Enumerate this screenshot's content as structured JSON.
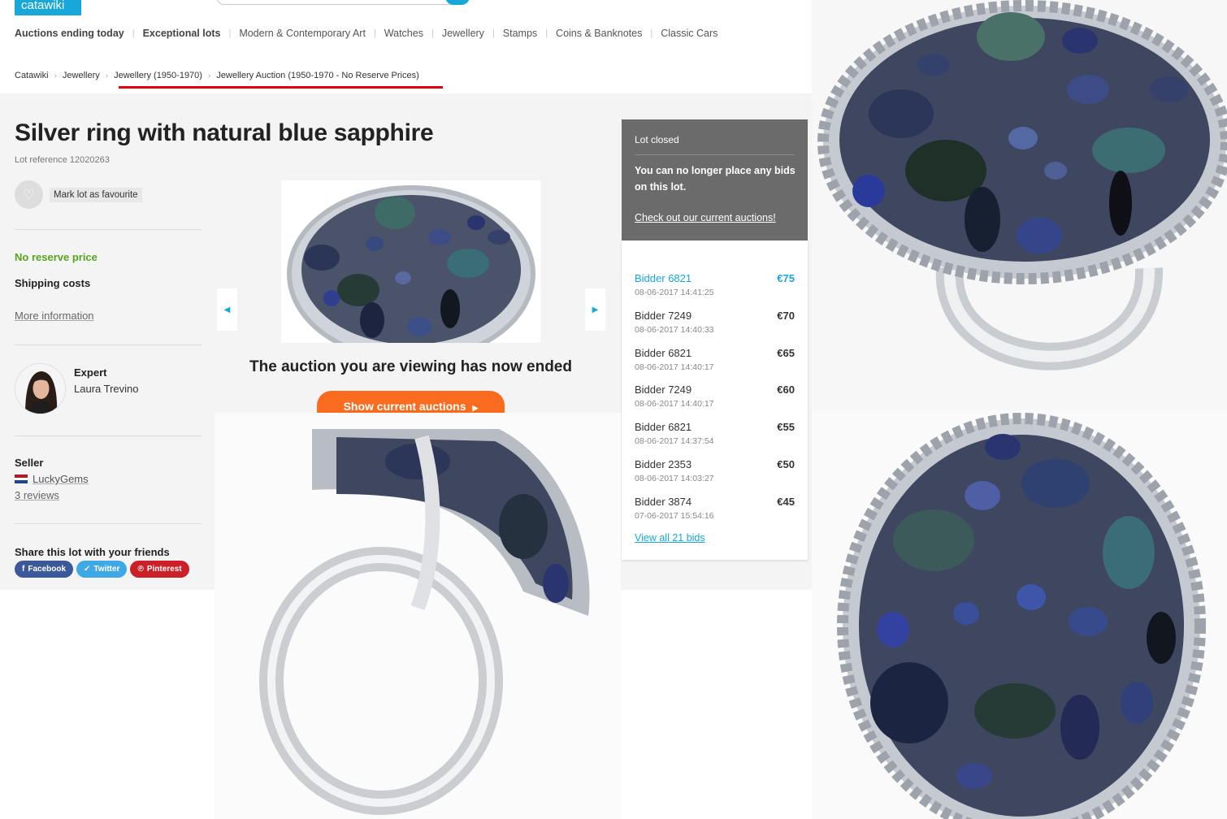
{
  "header": {
    "logo": "catawiki",
    "nav": [
      "Auctions ending today",
      "Exceptional lots",
      "Modern & Contemporary Art",
      "Watches",
      "Jewellery",
      "Stamps",
      "Coins & Banknotes",
      "Classic Cars"
    ],
    "breadcrumb": [
      "Catawiki",
      "Jewellery",
      "Jewellery (1950-1970)",
      "Jewellery Auction (1950-1970 - No Reserve Prices)"
    ]
  },
  "lot": {
    "title": "Silver ring with natural blue sapphire",
    "reference": "Lot reference 12020263",
    "favourite_label": "Mark lot as favourite",
    "no_reserve": "No reserve price",
    "shipping": "Shipping costs",
    "more_info": "More information"
  },
  "expert": {
    "label": "Expert",
    "name": "Laura Trevino"
  },
  "seller": {
    "label": "Seller",
    "name": "LuckyGems",
    "reviews": "3 reviews"
  },
  "share": {
    "title": "Share this lot with your friends",
    "facebook": "Facebook",
    "twitter": "Twitter",
    "pinterest": "Pinterest"
  },
  "gallery": {
    "ended_message": "The auction you are viewing has now ended",
    "show_current": "Show current auctions"
  },
  "status": {
    "title": "Lot closed",
    "message": "You can no longer place any bids on this lot.",
    "link": "Check out our current auctions!"
  },
  "bids": [
    {
      "bidder": "Bidder 6821",
      "time": "08-06-2017 14:41:25",
      "amount": "€75"
    },
    {
      "bidder": "Bidder 7249",
      "time": "08-06-2017 14:40:33",
      "amount": "€70"
    },
    {
      "bidder": "Bidder 6821",
      "time": "08-06-2017 14:40:17",
      "amount": "€65"
    },
    {
      "bidder": "Bidder 7249",
      "time": "08-06-2017 14:40:17",
      "amount": "€60"
    },
    {
      "bidder": "Bidder 6821",
      "time": "08-06-2017 14:37:54",
      "amount": "€55"
    },
    {
      "bidder": "Bidder 2353",
      "time": "08-06-2017 14:03:27",
      "amount": "€50"
    },
    {
      "bidder": "Bidder 3874",
      "time": "07-06-2017 15:54:16",
      "amount": "€45"
    }
  ],
  "bids_link": "View all 21 bids",
  "colors": {
    "accent": "#17a7d8",
    "green": "#55a51c",
    "orange": "#f96b1f",
    "highlight_red": "#e0000f",
    "closed_panel": "#6b6b6b"
  }
}
